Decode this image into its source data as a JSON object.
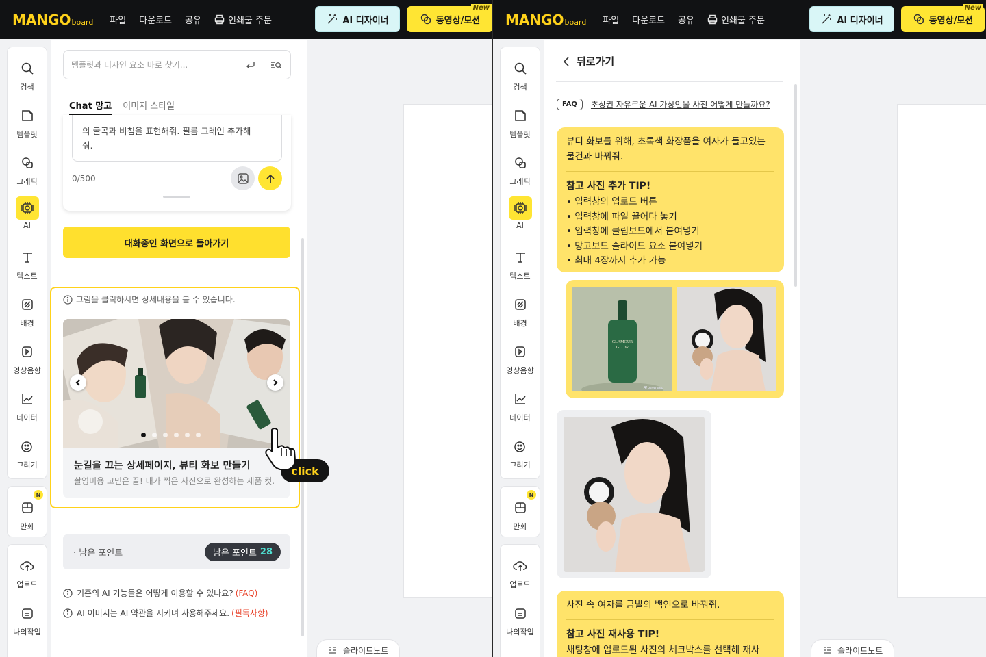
{
  "brand": {
    "logo_main": "MANGO",
    "logo_sub": "board",
    "accent": "#ffd21a"
  },
  "topbar": {
    "menu": [
      "파일",
      "다운로드",
      "공유",
      "인쇄물 주문"
    ],
    "ai_designer": "AI 디자이너",
    "video_motion": "동영상/모션",
    "new_badge": "New"
  },
  "sidebar": {
    "items": [
      "검색",
      "템플릿",
      "그래픽",
      "AI",
      "텍스트",
      "배경",
      "영상음향",
      "데이터",
      "그리기"
    ],
    "comic": "만화",
    "comic_badge": "N",
    "upload": "업로드",
    "mywork": "나의작업"
  },
  "left": {
    "search_placeholder": "템플릿과 디자인 요소 바로 찾기...",
    "tab_chat": "Chat 망고",
    "tab_style": "이미지 스타일",
    "chat_line1": "의 굴곡과 비침을 표현해줘. 필름 그레인 추가해",
    "chat_line2": "줘.",
    "char_count": "0/500",
    "back_to_chat": "대화중인 화면으로 돌아가기",
    "hint": "그림을 클릭하시면 상세내용을 볼 수 있습니다.",
    "card_title": "눈길을 끄는 상세페이지, 뷰티 화보 만들기",
    "card_sub": "촬영비용 고민은 끝! 내가 찍은 사진으로 완성하는 제품 컷.",
    "click_label": "click",
    "points_label": "· 남은 포인트",
    "points_pill": "남은 포인트",
    "points_value": "28",
    "info1": "기존의 AI 기능들은 어떻게 이용할 수 있나요?",
    "info1_link": "(FAQ)",
    "info2": "AI 이미지는 AI 약관을 지키며 사용해주세요.",
    "info2_link": "(필독사항)",
    "slide_note": "슬라이드노트"
  },
  "right": {
    "back": "뒤로가기",
    "faq_tag": "FAQ",
    "faq_link": "초상권 자유로운 AI 가상인물 사진 어떻게 만들까요?",
    "bubble1_line1": "뷰티 화보를 위해, 초록색 화장품을 여자가 들고있는",
    "bubble1_line2": "물건과 바꿔줘.",
    "tip1_title": "참고 사진 추가 TIP!",
    "tip1_items": [
      "• 입력창의 업로드 버튼",
      "• 입력창에 파일 끌어다 놓기",
      "• 입력창에 클립보드에서 붙여넣기",
      "• 망고보드 슬라이드 요소 붙여넣기",
      "• 최대 4장까지 추가 가능"
    ],
    "product_label1": "GLAMOUR",
    "product_label2": "GLOW",
    "watermark": "AI generated",
    "bubble2_line1": "사진 속 여자를 금발의 백인으로 바꿔줘.",
    "tip2_title": "참고 사진 재사용 TIP!",
    "tip2_line1": "채팅창에 업로드된 사진의 체크박스를 선택해 재사"
  }
}
